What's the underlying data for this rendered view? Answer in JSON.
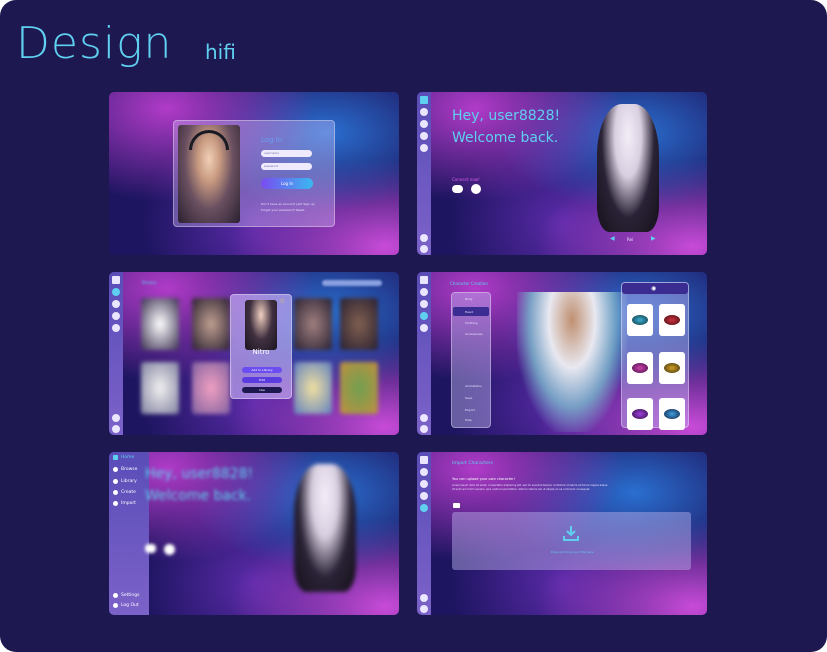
{
  "header": {
    "title": "Design",
    "subtitle": "hifi"
  },
  "login": {
    "title": "Log In",
    "username_placeholder": "username",
    "password_placeholder": "password",
    "login_button": "Log In",
    "footer_line1": "Don't have an account yet? Sign up",
    "footer_line2": "Forgot your password? Reset"
  },
  "home": {
    "greeting_line1": "Hey, user8828!",
    "greeting_line2": "Welcome back.",
    "connect_label": "Connect now!",
    "character_name": "Rei"
  },
  "library": {
    "heading": "Browse",
    "popup_name": "Nitro",
    "add_button": "Add to Library",
    "edit_button": "Edit",
    "use_button": "Use"
  },
  "creation": {
    "heading": "Character Creation",
    "menu_top": [
      "Body",
      "Head",
      "Clothing",
      "Accessories"
    ],
    "menu_bottom": [
      "Animations",
      "Save",
      "Export",
      "Help"
    ]
  },
  "sidebar": {
    "items": [
      "Home",
      "Browse",
      "Library",
      "Create",
      "Import"
    ],
    "bottom_items": [
      "Settings",
      "Log Out"
    ],
    "greeting_line1": "Hey, user8828!",
    "greeting_line2": "Welcome back."
  },
  "import": {
    "heading": "Import Characters",
    "intro": "You can upload your own character!",
    "body_line1": "Lorem ipsum dolor sit amet, consectetur adipiscing elit, sed do eiusmod tempor incididunt ut labore et dolore magna aliqua.",
    "body_line2": "Ut enim ad minim veniam, quis nostrud exercitation ullamco laboris nisi ut aliquip ex ea commodo consequat.",
    "drop_label": "Drag and drop your file here"
  },
  "colors": {
    "accent": "#5fd0f0",
    "board": "#1e1850",
    "rail": "#6a58c0"
  }
}
